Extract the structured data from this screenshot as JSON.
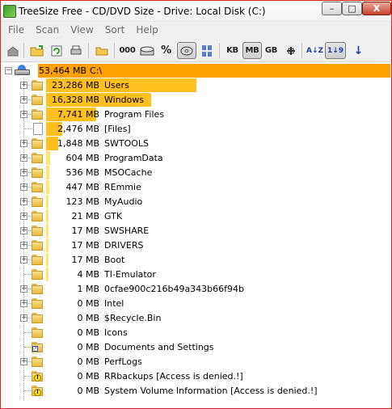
{
  "window": {
    "title": "TreeSize Free - CD/DVD Size - Drive: Local Disk (C:)",
    "controls": {
      "minimize": "–",
      "maximize": "□",
      "close": "X"
    }
  },
  "menu": [
    "File",
    "Scan",
    "View",
    "Sort",
    "Help"
  ],
  "toolbar": {
    "buttons": [
      {
        "name": "home-icon"
      },
      {
        "name": "open-folder-icon"
      },
      {
        "name": "refresh-icon"
      },
      {
        "name": "print-icon"
      },
      {
        "name": "folder-select-icon"
      },
      {
        "name": "size-format-button",
        "label": "000"
      },
      {
        "name": "allocated-space-icon"
      },
      {
        "name": "percent-button",
        "label": "%"
      },
      {
        "name": "cd-dvd-size-icon"
      },
      {
        "name": "file-count-icon"
      },
      {
        "name": "kb-button",
        "label": "KB"
      },
      {
        "name": "mb-button",
        "label": "MB"
      },
      {
        "name": "gb-button",
        "label": "GB"
      },
      {
        "name": "auto-units-icon"
      },
      {
        "name": "sort-by-name-icon",
        "label": "A↓Z"
      },
      {
        "name": "sort-by-size-icon",
        "label": "1↓9"
      },
      {
        "name": "sort-descending-icon",
        "label": "↓"
      }
    ],
    "active": [
      "mb-button",
      "cd-dvd-size-icon",
      "sort-by-size-icon"
    ]
  },
  "root": {
    "size": "53,464 MB",
    "name": "C:\\",
    "fill": 1.0
  },
  "items": [
    {
      "size": "23,286 MB",
      "name": "Users",
      "type": "folder",
      "expandable": true,
      "fill": 0.4356
    },
    {
      "size": "16,328 MB",
      "name": "Windows",
      "type": "folder",
      "expandable": true,
      "fill": 0.3054
    },
    {
      "size": "7,741 MB",
      "name": "Program Files",
      "type": "folder",
      "expandable": true,
      "fill": 0.1448
    },
    {
      "size": "2,476 MB",
      "name": "[Files]",
      "type": "file",
      "expandable": false,
      "fill": 0.0463
    },
    {
      "size": "1,848 MB",
      "name": "SWTOOLS",
      "type": "folder",
      "expandable": true,
      "fill": 0.0346
    },
    {
      "size": "604 MB",
      "name": "ProgramData",
      "type": "folder",
      "expandable": true,
      "fill": 0.0113
    },
    {
      "size": "536 MB",
      "name": "MSOCache",
      "type": "folder",
      "expandable": true,
      "fill": 0.01
    },
    {
      "size": "447 MB",
      "name": "REmmie",
      "type": "folder",
      "expandable": true,
      "fill": 0.0084
    },
    {
      "size": "123 MB",
      "name": "MyAudio",
      "type": "folder",
      "expandable": true,
      "fill": 0.0023
    },
    {
      "size": "21 MB",
      "name": "GTK",
      "type": "folder",
      "expandable": true,
      "fill": 0.0004
    },
    {
      "size": "17 MB",
      "name": "SWSHARE",
      "type": "folder",
      "expandable": true,
      "fill": 0.0003
    },
    {
      "size": "17 MB",
      "name": "DRIVERS",
      "type": "folder",
      "expandable": true,
      "fill": 0.0003
    },
    {
      "size": "17 MB",
      "name": "Boot",
      "type": "folder",
      "expandable": true,
      "fill": 0.0003
    },
    {
      "size": "4 MB",
      "name": "TI-Emulator",
      "type": "folder",
      "expandable": false,
      "fill": 0.0001
    },
    {
      "size": "1 MB",
      "name": "0cfae900c216b49a343b66f94b",
      "type": "folder",
      "expandable": true,
      "fill": 0
    },
    {
      "size": "0 MB",
      "name": "Intel",
      "type": "folder",
      "expandable": true,
      "fill": 0
    },
    {
      "size": "0 MB",
      "name": "$Recycle.Bin",
      "type": "folder",
      "expandable": true,
      "fill": 0
    },
    {
      "size": "0 MB",
      "name": "Icons",
      "type": "folder",
      "expandable": false,
      "fill": 0
    },
    {
      "size": "0 MB",
      "name": "Documents and Settings",
      "type": "shortcut",
      "expandable": false,
      "fill": 0
    },
    {
      "size": "0 MB",
      "name": "PerfLogs",
      "type": "folder",
      "expandable": true,
      "fill": 0
    },
    {
      "size": "0 MB",
      "name": "RRbackups  [Access is denied.!]",
      "type": "denied",
      "expandable": false,
      "fill": 0
    },
    {
      "size": "0 MB",
      "name": "System Volume Information  [Access is denied.!]",
      "type": "denied",
      "expandable": false,
      "fill": 0
    }
  ],
  "colors": {
    "bar_root": "#ffa200",
    "bar_main": "#ffbf1f",
    "bar_light": "#ffe66d",
    "window_border": "#d42a1e"
  }
}
